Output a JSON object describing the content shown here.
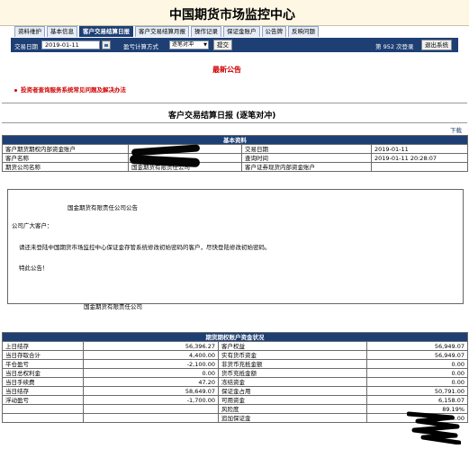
{
  "banner": {
    "title": "中国期货市场监控中心"
  },
  "tabs": [
    {
      "label": "资料维护",
      "active": false
    },
    {
      "label": "基本信息",
      "active": false
    },
    {
      "label": "客户交易结算日报",
      "active": true
    },
    {
      "label": "客户交易结算月报",
      "active": false
    },
    {
      "label": "操作记录",
      "active": false
    },
    {
      "label": "保证金账户",
      "active": false
    },
    {
      "label": "公告牌",
      "active": false
    },
    {
      "label": "反映问题",
      "active": false
    }
  ],
  "toolbar": {
    "date_label": "交易日期",
    "date_value": "2019-01-11",
    "calc_label": "盈亏计算方式",
    "calc_value": "逐笔对冲",
    "submit_label": "提交",
    "login_count": "第 952 次登录",
    "logout_label": "退出系统"
  },
  "notice": {
    "title": "最新公告",
    "item": "投资者查询服务系统常见问题及解决办法"
  },
  "report": {
    "title": "客户交易结算日报 (逐笔对冲)",
    "download": "下载"
  },
  "basic": {
    "header": "基本资料",
    "rows": [
      [
        "客户期货期权内部资金账户",
        "",
        "交易日期",
        "2019-01-11"
      ],
      [
        "客户名称",
        "",
        "查询时间",
        "2019-01-11 20:28:07"
      ],
      [
        "期货公司名称",
        "国金期货有限责任公司",
        "客户证券现货内部资金账户",
        ""
      ]
    ]
  },
  "announcement": {
    "company_line": "国金期货有限责任公司公告",
    "greeting": "公司广大客户：",
    "body": "请还未登陆中国期货市场监控中心保证金存管系统修改初始密码的客户，尽快登陆修改初始密码。",
    "closing": "特此公告！",
    "signature": "国金期货有限责任公司"
  },
  "funds": {
    "header": "期货期权账户资金状况",
    "rows": [
      [
        "上日结存",
        "56,396.27",
        "客户权益",
        "56,949.07"
      ],
      [
        "当日存取合计",
        "4,400.00",
        "实有货币资金",
        "56,949.07"
      ],
      [
        "平仓盈亏",
        "-2,100.00",
        "非货币充抵金额",
        "0.00"
      ],
      [
        "当日总权利金",
        "0.00",
        "货币充抵金额",
        "0.00"
      ],
      [
        "当日手续费",
        "47.20",
        "冻结资金",
        "0.00"
      ],
      [
        "当日结存",
        "58,649.07",
        "保证金占用",
        "50,791.00"
      ],
      [
        "浮动盈亏",
        "-1,700.00",
        "可用资金",
        "6,158.07"
      ],
      [
        "",
        "",
        "风险度",
        "89.19%"
      ],
      [
        "",
        "",
        "追加保证金",
        "0.00"
      ]
    ]
  },
  "colors": {
    "navy": "#1d3f74",
    "notice_red": "#d00000",
    "banner_bg": "#fdf7e4"
  }
}
